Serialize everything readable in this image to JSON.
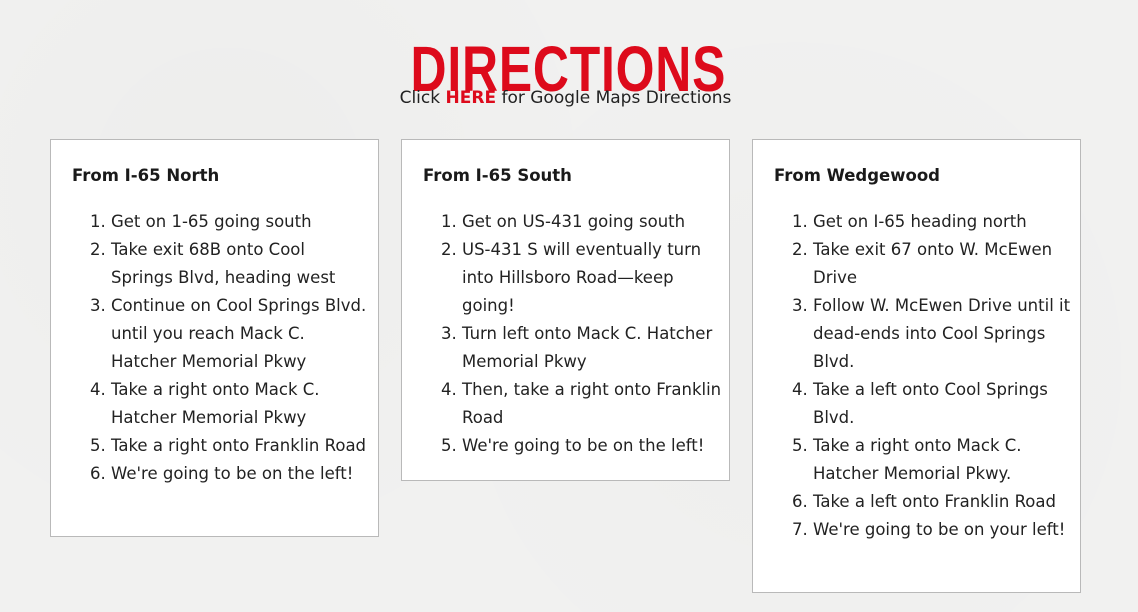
{
  "header": {
    "title": "DIRECTIONS",
    "subtitle_prefix": "Click ",
    "subtitle_link": "HERE",
    "subtitle_suffix": " for Google Maps Directions"
  },
  "colors": {
    "accent": "#dd0a1b",
    "background": "#f1f1f0",
    "card_border": "#b9b9b9"
  },
  "cards": [
    {
      "title": "From I-65 North",
      "steps": [
        "Get on 1-65 going south",
        "Take exit 68B onto Cool Springs Blvd, heading west",
        "Continue on Cool Springs Blvd. until you reach Mack C. Hatcher Memorial Pkwy",
        "Take a right onto Mack C. Hatcher Memorial Pkwy",
        "Take a right onto Franklin Road",
        "We're going to be on the left!"
      ]
    },
    {
      "title": "From I-65 South",
      "steps": [
        "Get on US-431 going south",
        "US-431 S will eventually turn into Hillsboro Road—keep going!",
        "Turn left onto Mack C. Hatcher Memorial Pkwy",
        "Then, take a right onto Franklin Road",
        "We're going to be on the left!"
      ]
    },
    {
      "title": "From Wedgewood",
      "steps": [
        "Get on I-65 heading north",
        "Take exit 67 onto W. McEwen Drive",
        "Follow W. McEwen Drive until it dead-ends into Cool Springs Blvd.",
        "Take a left onto Cool Springs Blvd.",
        "Take a right onto Mack C. Hatcher Memorial Pkwy.",
        "Take a left onto Franklin Road",
        "We're going to be on your left!"
      ]
    }
  ]
}
